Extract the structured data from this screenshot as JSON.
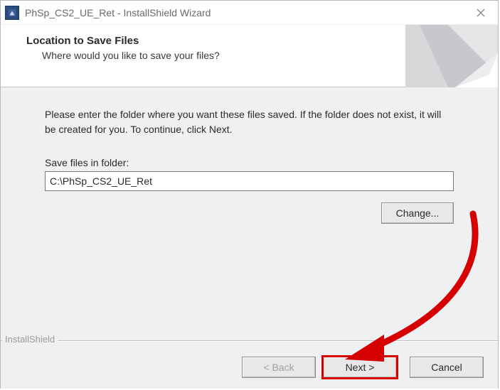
{
  "titlebar": {
    "title": "PhSp_CS2_UE_Ret - InstallShield Wizard"
  },
  "header": {
    "title": "Location to Save Files",
    "subtitle": "Where would you like to save your files?"
  },
  "content": {
    "instructions": "Please enter the folder where you want these files saved.  If the folder does not exist, it will be created for you.   To continue, click Next.",
    "folder_label": "Save files in folder:",
    "folder_value": "C:\\PhSp_CS2_UE_Ret",
    "change_label": "Change..."
  },
  "footer": {
    "brand": "InstallShield",
    "back_label": "< Back",
    "next_label": "Next >",
    "cancel_label": "Cancel"
  }
}
